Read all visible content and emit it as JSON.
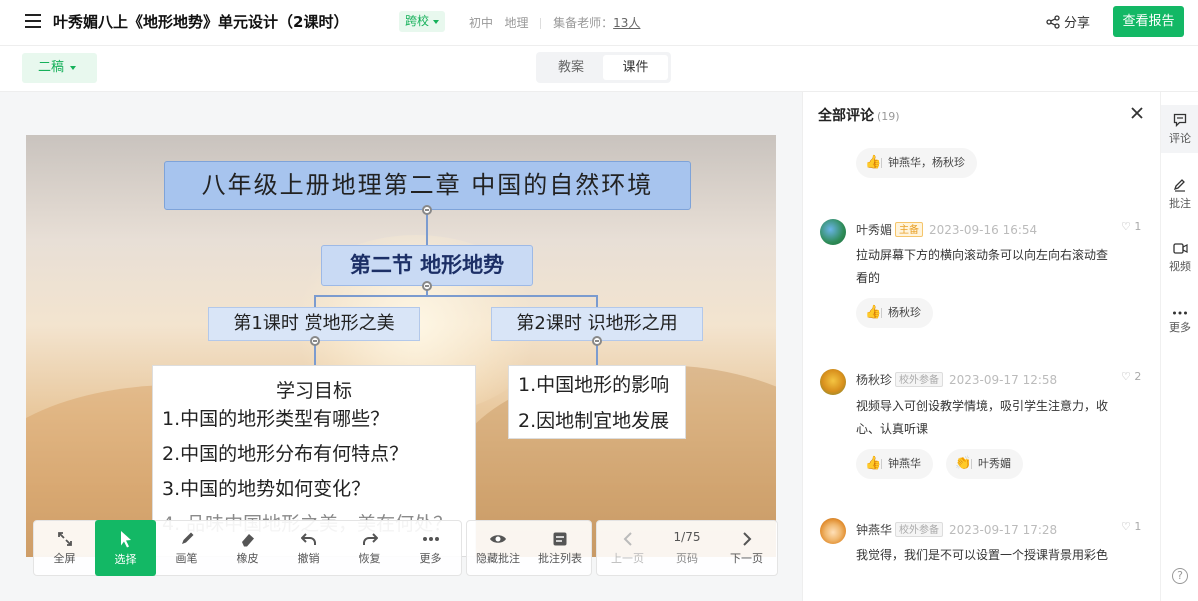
{
  "header": {
    "title": "叶秀媚八上《地形地势》单元设计（2课时）",
    "cross_school": "跨校",
    "grade": "初中",
    "subject": "地理",
    "teachers_label": "集备老师：",
    "teachers_count": "13人",
    "share": "分享",
    "report_button": "查看报告"
  },
  "subbar": {
    "draft": "二稿",
    "tabs": [
      "教案",
      "课件"
    ],
    "active_tab": "课件"
  },
  "slide": {
    "title": "八年级上册地理第二章  中国的自然环境",
    "section": "第二节    地形地势",
    "lesson1": "第1课时   赏地形之美",
    "lesson2": "第2课时   识地形之用",
    "goals_head": "学习目标",
    "goals": [
      "1.中国的地形类型有哪些？",
      "2.中国的地形分布有何特点？",
      "3.中国的地势如何变化？",
      "4. 品味中国地形之美，美在何处？"
    ],
    "influence": [
      "1.中国地形的影响",
      "2.因地制宜地发展"
    ]
  },
  "toolbar": {
    "fullscreen": "全屏",
    "select": "选择",
    "pen": "画笔",
    "eraser": "橡皮",
    "undo": "撤销",
    "redo": "恢复",
    "more": "更多",
    "hide_notes": "隐藏批注",
    "notes_list": "批注列表",
    "prev": "上一页",
    "page": "1/75",
    "page_label": "页码",
    "next": "下一页"
  },
  "comments_panel": {
    "title": "全部评论",
    "count": "(19)",
    "top_likes": "钟燕华，杨秋珍",
    "comments": [
      {
        "name": "叶秀媚",
        "badge": "主备",
        "time": "2023-09-16 16:54",
        "likes": "1",
        "text1": "拉动屏幕下方的横向滚动条可以向左向右滚动查",
        "text2": "看的",
        "reactions": [
          "杨秋珍"
        ]
      },
      {
        "name": "杨秋珍",
        "badge": "校外参备",
        "time": "2023-09-17 12:58",
        "likes": "2",
        "text1": "视频导入可创设教学情境，吸引学生注意力，收",
        "text2": "心、认真听课",
        "reactions": [
          "钟燕华",
          "叶秀媚"
        ]
      },
      {
        "name": "钟燕华",
        "badge": "校外参备",
        "time": "2023-09-17 17:28",
        "likes": "1",
        "text1": "我觉得，我们是不可以设置一个授课背景用彩色"
      }
    ]
  },
  "rail": {
    "comment": "评论",
    "note": "批注",
    "video": "视频",
    "more": "更多",
    "help": "?"
  }
}
